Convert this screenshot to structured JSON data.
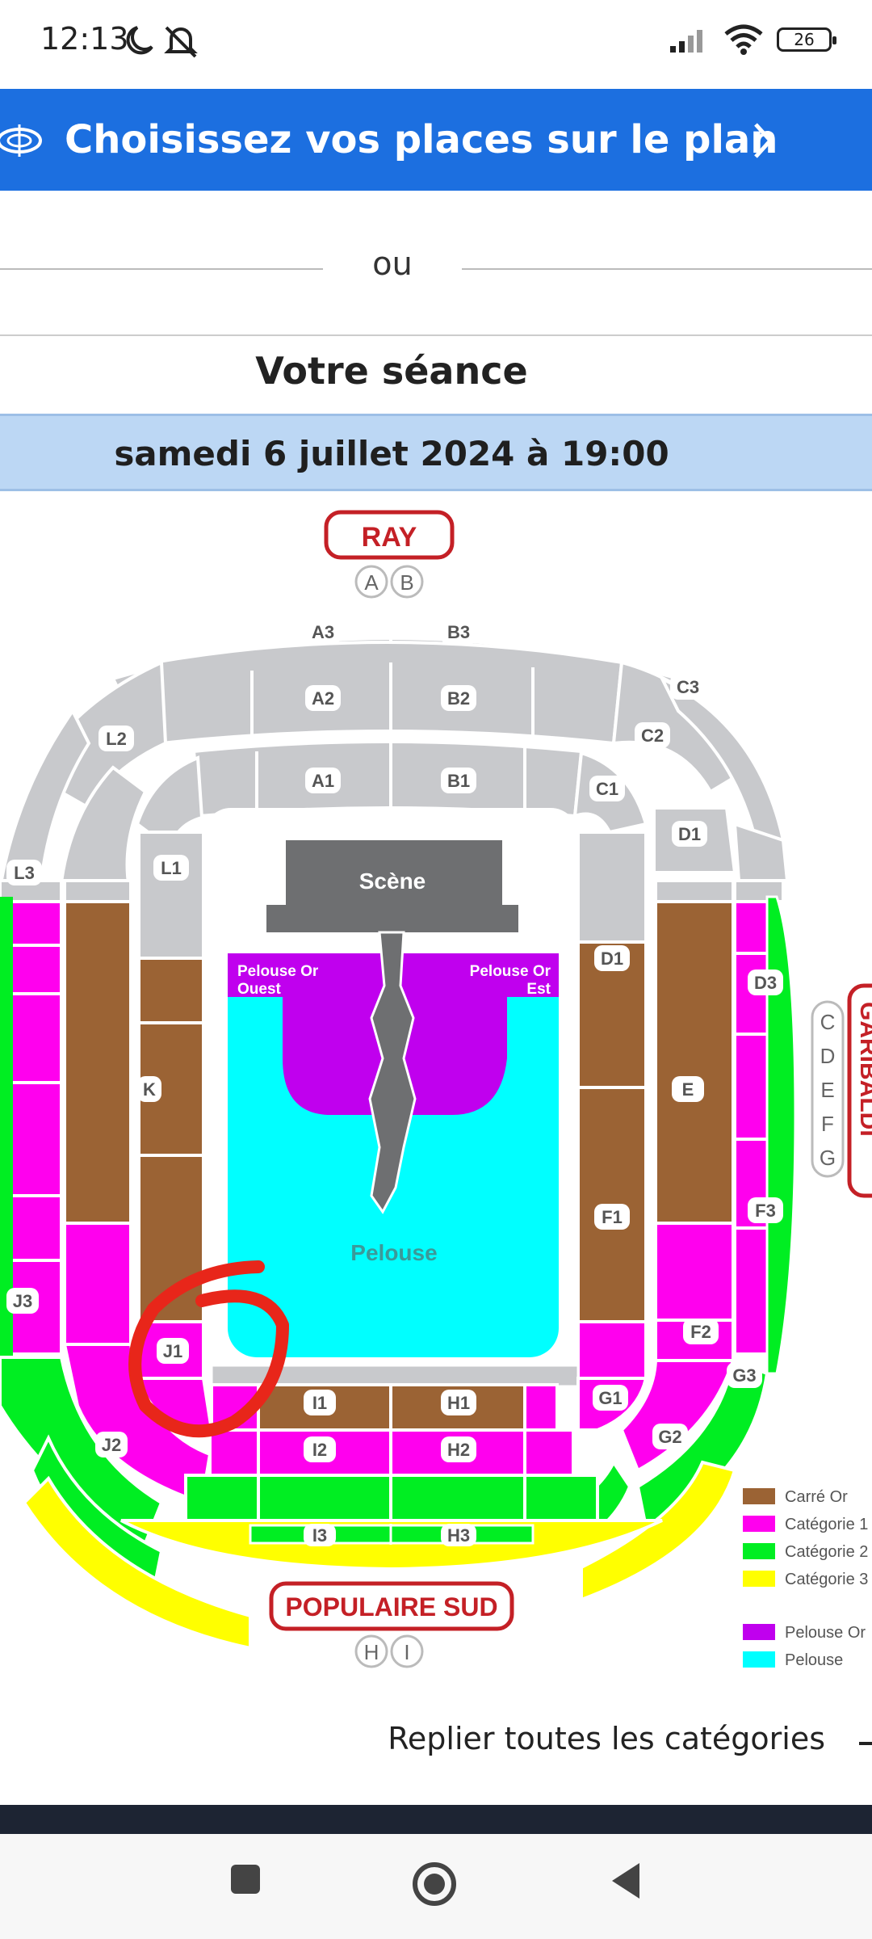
{
  "status_bar": {
    "time": "12:13",
    "battery": "26"
  },
  "banner": {
    "text": "Choisissez vos places sur le plan"
  },
  "divider": {
    "text": "ou"
  },
  "seance": {
    "title": "Votre séance",
    "date": "samedi 6 juillet 2024 à 19:00"
  },
  "stadium": {
    "stands": {
      "north": "RAY",
      "south": "POPULAIRE SUD",
      "east": "GARIBALDI"
    },
    "gates_north": [
      "A",
      "B"
    ],
    "gates_south": [
      "H",
      "I"
    ],
    "gates_east": [
      "C",
      "D",
      "E",
      "F",
      "G"
    ],
    "stage": "Scène",
    "pelouse": "Pelouse",
    "pelouse_or_ouest": "Pelouse Or Ouest",
    "pelouse_or_est": "Pelouse Or Est",
    "sections": {
      "A3": "A3",
      "B3": "B3",
      "A2": "A2",
      "B2": "B2",
      "A1": "A1",
      "B1": "B1",
      "C3": "C3",
      "C2": "C2",
      "C1": "C1",
      "D1a": "D1",
      "D1b": "D1",
      "D3": "D3",
      "E": "E",
      "F1": "F1",
      "F2": "F2",
      "F3": "F3",
      "G1": "G1",
      "G2": "G2",
      "G3": "G3",
      "H1": "H1",
      "H2": "H2",
      "H3": "H3",
      "I1": "I1",
      "I2": "I2",
      "I3": "I3",
      "J1": "J1",
      "J2": "J2",
      "J3": "J3",
      "K": "K",
      "L1": "L1",
      "L2": "L2",
      "L3": "L3"
    },
    "legend": [
      {
        "label": "Carré Or",
        "color": "#9b6334"
      },
      {
        "label": "Catégorie 1",
        "color": "#ff00ee"
      },
      {
        "label": "Catégorie 2",
        "color": "#00ee22"
      },
      {
        "label": "Catégorie 3",
        "color": "#ffff00"
      },
      {
        "label": "Pelouse Or",
        "color": "#c000ee"
      },
      {
        "label": "Pelouse",
        "color": "#00ffff"
      }
    ],
    "colors": {
      "grey": "#c8c9cc",
      "brown": "#9b6334",
      "magenta": "#ff00ee",
      "green": "#00ee22",
      "yellow": "#ffff00",
      "purple": "#c000ee",
      "cyan": "#00ffff",
      "stand_red": "#c42026",
      "stage": "#6e6f71",
      "annotation": "#e8261a"
    }
  },
  "actions": {
    "collapse": "Replier toutes les catégories"
  }
}
